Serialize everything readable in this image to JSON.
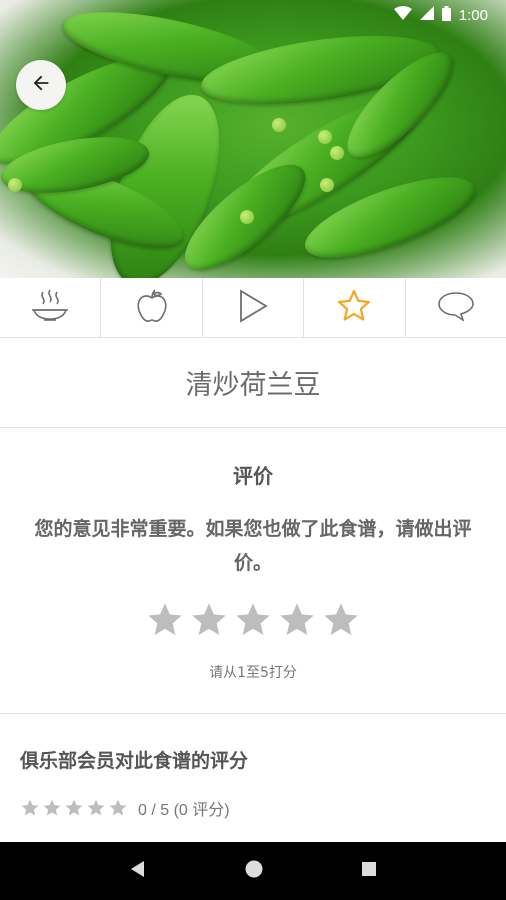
{
  "status_bar": {
    "time": "1:00"
  },
  "header": {
    "back_icon": "arrow-left-icon"
  },
  "tabs": [
    {
      "name": "tab-cooking",
      "icon": "dish-icon"
    },
    {
      "name": "tab-nutrition",
      "icon": "apple-icon"
    },
    {
      "name": "tab-video",
      "icon": "play-icon"
    },
    {
      "name": "tab-rating",
      "icon": "star-icon",
      "active": true
    },
    {
      "name": "tab-comments",
      "icon": "comment-icon"
    }
  ],
  "recipe": {
    "title": "清炒荷兰豆"
  },
  "rating": {
    "heading": "评价",
    "message": "您的意见非常重要。如果您也做了此食谱，请做出评价。",
    "stars_max": 5,
    "hint": "请从1至5打分"
  },
  "club": {
    "heading": "俱乐部会员对此食谱的评分",
    "score_text": "0 / 5 (0 评分)",
    "score": 0,
    "count": 0
  },
  "colors": {
    "accent": "#f5a623",
    "star_gray": "#bdbdbd",
    "tab_icon": "#6f6f6f"
  },
  "nav": {
    "back": "back-triangle-icon",
    "home": "home-circle-icon",
    "recents": "recents-square-icon"
  }
}
